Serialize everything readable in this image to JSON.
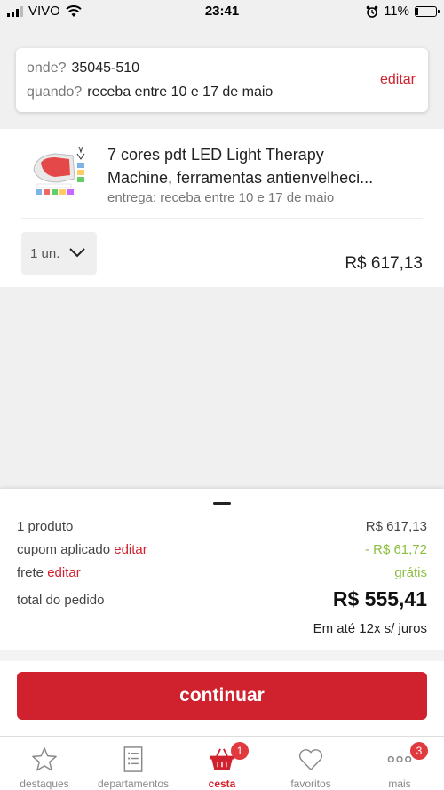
{
  "status_bar": {
    "carrier": "VIVO",
    "time": "23:41",
    "battery": "11%"
  },
  "delivery": {
    "where_label": "onde?",
    "where_value": "35045-510",
    "when_label": "quando?",
    "when_value": "receba entre 10 e 17 de maio",
    "edit_label": "editar"
  },
  "product": {
    "title_line1": "7 cores pdt LED Light Therapy",
    "title_line2": "Machine, ferramentas antienvelheci...",
    "delivery_text": "entrega: receba entre 10 e 17 de maio",
    "quantity": "1 un.",
    "price": "R$ 617,13"
  },
  "summary": {
    "products_label": "1 produto",
    "products_value": "R$ 617,13",
    "coupon_label": "cupom aplicado",
    "coupon_edit": "editar",
    "coupon_value": "- R$ 61,72",
    "shipping_label": "frete",
    "shipping_edit": "editar",
    "shipping_value": "grátis",
    "total_label": "total do pedido",
    "total_value": "R$ 555,41",
    "installments": "Em até 12x s/ juros"
  },
  "continue_button": "continuar",
  "tabs": [
    {
      "label": "destaques",
      "icon": "star-icon"
    },
    {
      "label": "departamentos",
      "icon": "list-icon"
    },
    {
      "label": "cesta",
      "icon": "basket-icon",
      "badge": "1",
      "active": true
    },
    {
      "label": "favoritos",
      "icon": "heart-icon"
    },
    {
      "label": "mais",
      "icon": "more-icon",
      "badge": "3"
    }
  ],
  "colors": {
    "accent": "#d0222e",
    "green": "#8cbf3f",
    "badge": "#e0393e"
  }
}
